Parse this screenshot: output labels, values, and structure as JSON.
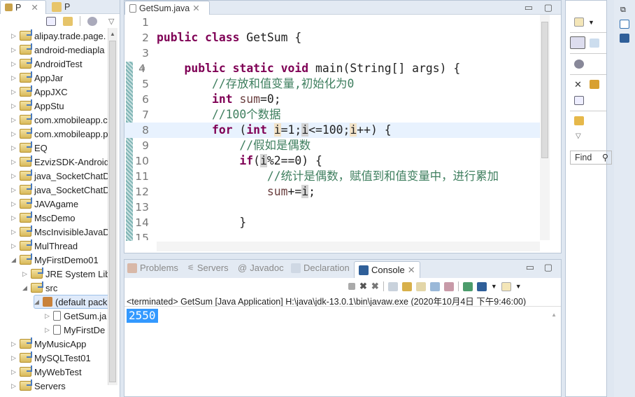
{
  "left_panel": {
    "tabs": [
      {
        "label": "P",
        "active": true
      },
      {
        "label": "P",
        "active": false
      }
    ],
    "tree": [
      {
        "label": "alipay.trade.page.",
        "level": 0,
        "expanded": false
      },
      {
        "label": "android-mediapla",
        "level": 0,
        "expanded": false
      },
      {
        "label": "AndroidTest",
        "level": 0,
        "expanded": false
      },
      {
        "label": "AppJar",
        "level": 0,
        "expanded": false
      },
      {
        "label": "AppJXC",
        "level": 0,
        "expanded": false
      },
      {
        "label": "AppStu",
        "level": 0,
        "expanded": false
      },
      {
        "label": "com.xmobileapp.c",
        "level": 0,
        "expanded": false
      },
      {
        "label": "com.xmobileapp.p",
        "level": 0,
        "expanded": false
      },
      {
        "label": "EQ",
        "level": 0,
        "expanded": false
      },
      {
        "label": "EzvizSDK-Android",
        "level": 0,
        "expanded": false
      },
      {
        "label": "java_SocketChatDe",
        "level": 0,
        "expanded": false
      },
      {
        "label": "java_SocketChatDe",
        "level": 0,
        "expanded": false
      },
      {
        "label": "JAVAgame",
        "level": 0,
        "expanded": false
      },
      {
        "label": "MscDemo",
        "level": 0,
        "expanded": false
      },
      {
        "label": "MscInvisibleJavaD",
        "level": 0,
        "expanded": false
      },
      {
        "label": "MulThread",
        "level": 0,
        "expanded": false
      },
      {
        "label": "MyFirstDemo01",
        "level": 0,
        "expanded": true
      },
      {
        "label": "JRE System Libr",
        "level": 1,
        "expanded": false
      },
      {
        "label": "src",
        "level": 1,
        "expanded": true
      },
      {
        "label": "(default pack",
        "level": 2,
        "expanded": true,
        "selected": true
      },
      {
        "label": "GetSum.ja",
        "level": 3,
        "expanded": false
      },
      {
        "label": "MyFirstDe",
        "level": 3,
        "expanded": false
      },
      {
        "label": "MyMusicApp",
        "level": 0,
        "expanded": false
      },
      {
        "label": "MySQLTest01",
        "level": 0,
        "expanded": false
      },
      {
        "label": "MyWebTest",
        "level": 0,
        "expanded": false
      },
      {
        "label": "Servers",
        "level": 0,
        "expanded": false
      }
    ]
  },
  "editor": {
    "tab": "GetSum.java",
    "lines": [
      [],
      [
        [
          "kw",
          "public"
        ],
        [
          "t",
          " "
        ],
        [
          "kw",
          "class"
        ],
        [
          "t",
          " GetSum {"
        ]
      ],
      [],
      [
        [
          "t",
          "    "
        ],
        [
          "kw",
          "public"
        ],
        [
          "t",
          " "
        ],
        [
          "kw",
          "static"
        ],
        [
          "t",
          " "
        ],
        [
          "kw",
          "void"
        ],
        [
          "t",
          " main(String[] args) {"
        ]
      ],
      [
        [
          "t",
          "        "
        ],
        [
          "cm",
          "//存放和值变量,初始化为0"
        ]
      ],
      [
        [
          "t",
          "        "
        ],
        [
          "kw",
          "int"
        ],
        [
          "t",
          " "
        ],
        [
          "var",
          "sum"
        ],
        [
          "t",
          "=0;"
        ]
      ],
      [
        [
          "t",
          "        "
        ],
        [
          "cm",
          "//100个数据"
        ]
      ],
      [
        [
          "t",
          "        "
        ],
        [
          "kw",
          "for"
        ],
        [
          "t",
          " ("
        ],
        [
          "kw",
          "int"
        ],
        [
          "t",
          " "
        ],
        [
          "occ",
          "i"
        ],
        [
          "t",
          "=1;"
        ],
        [
          "occw",
          "i"
        ],
        [
          "t",
          "<=100;"
        ],
        [
          "occ",
          "i"
        ],
        [
          "t",
          "++) {"
        ]
      ],
      [
        [
          "t",
          "            "
        ],
        [
          "cm",
          "//假如是偶数"
        ]
      ],
      [
        [
          "t",
          "            "
        ],
        [
          "kw",
          "if"
        ],
        [
          "t",
          "("
        ],
        [
          "occw",
          "i"
        ],
        [
          "t",
          "%2==0) {"
        ]
      ],
      [
        [
          "t",
          "                "
        ],
        [
          "cm",
          "//统计是偶数，赋值到和值变量中，进行累加"
        ]
      ],
      [
        [
          "t",
          "                "
        ],
        [
          "var",
          "sum"
        ],
        [
          "t",
          "+="
        ],
        [
          "occw",
          "i"
        ],
        [
          "t",
          ";"
        ]
      ],
      [],
      [
        [
          "t",
          "            }"
        ]
      ],
      []
    ],
    "current_line": 8
  },
  "console_panel": {
    "tabs": [
      "Problems",
      "Servers",
      "Javadoc",
      "Declaration",
      "Console"
    ],
    "active_tab": "Console",
    "status": "<terminated> GetSum [Java Application] H:\\java\\jdk-13.0.1\\bin\\javaw.exe (2020年10月4日 下午9:46:00)",
    "output": "2550"
  },
  "outline_panel": {
    "find_placeholder": "Find"
  }
}
